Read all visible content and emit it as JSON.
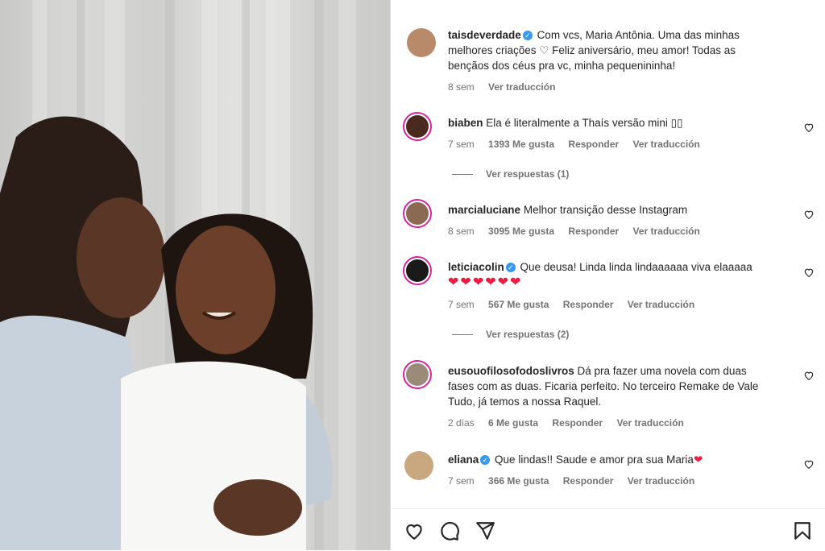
{
  "post": {
    "author": "taisdeverdade",
    "caption": "Com vcs, Maria Antônia. Uma das minhas melhores criações ♡ Feliz aniversário, meu amor! Todas as bençãos dos céus pra vc, minha pequenininha!",
    "caption_l1": "Com vcs, Maria Antônia. Uma das minhas",
    "caption_l2": "melhores criações ♡ Feliz aniversário, meu amor! Todas as",
    "caption_l3": "bençãos dos céus pra vc, minha pequenininha!",
    "time": "8 sem",
    "translate": "Ver traducción"
  },
  "comments": [
    {
      "user": "biaben",
      "text": "Ela é literalmente a Thaís versão mini ▯▯",
      "time": "7 sem",
      "likes": "1393 Me gusta",
      "reply": "Responder",
      "translate": "Ver traducción",
      "replies": "Ver respuestas (1)"
    },
    {
      "user": "marcialuciane",
      "text": "Melhor transição desse Instagram",
      "time": "8 sem",
      "likes": "3095 Me gusta",
      "reply": "Responder",
      "translate": "Ver traducción"
    },
    {
      "user": "leticiacolin",
      "text": "Que deusa! Linda linda lindaaaaaa viva elaaaaa",
      "hearts": "❤︎❤︎❤︎❤︎❤︎❤︎",
      "time": "7 sem",
      "likes": "567 Me gusta",
      "reply": "Responder",
      "translate": "Ver traducción",
      "replies": "Ver respuestas (2)"
    },
    {
      "user": "eusouofilosofodoslivros",
      "text_l1": "Dá pra fazer uma novela com duas",
      "text_l2": "fases com as duas. Ficaria perfeito. No terceiro Remake de Vale",
      "text_l3": "Tudo, já temos a nossa Raquel.",
      "time": "2 días",
      "likes": "6 Me gusta",
      "reply": "Responder",
      "translate": "Ver traducción"
    },
    {
      "user": "eliana",
      "text": "Que lindas!! Saude e amor pra sua Maria",
      "heart": "❤︎",
      "time": "7 sem",
      "likes": "366 Me gusta",
      "reply": "Responder",
      "translate": "Ver traducción"
    }
  ],
  "icons": [
    "heart-icon",
    "comment-icon",
    "share-icon",
    "bookmark-icon",
    "verified-badge-icon"
  ],
  "colors": {
    "verified": "#3897f0",
    "heart_red": "#ed1c40",
    "story_ring": "#d6249f"
  }
}
